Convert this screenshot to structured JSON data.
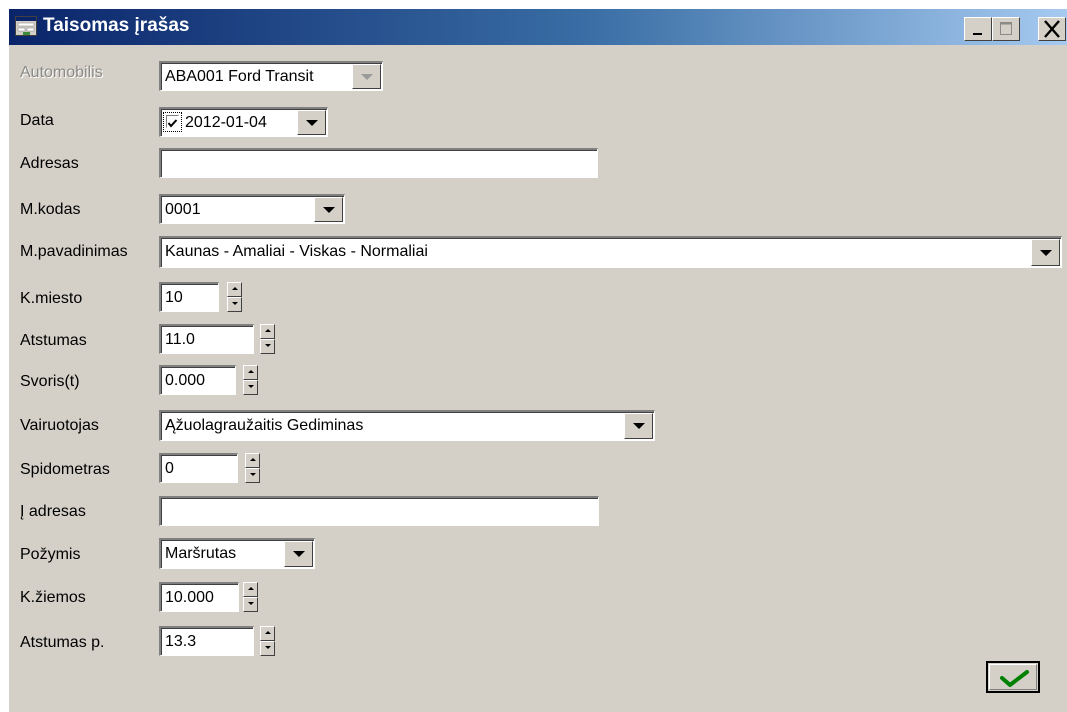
{
  "window": {
    "title": "Taisomas įrašas",
    "icon": "window-form-icon",
    "controls": [
      "minimize-icon",
      "maximize-icon",
      "close-icon"
    ]
  },
  "form": {
    "automobilis": {
      "label": "Automobilis",
      "value": "ABA001 Ford Transit",
      "enabled": false
    },
    "data": {
      "label": "Data",
      "checked": true,
      "value": "2012-01-04"
    },
    "adresas": {
      "label": "Adresas",
      "value": ""
    },
    "m_kodas": {
      "label": "M.kodas",
      "value": "0001"
    },
    "m_pavadinimas": {
      "label": "M.pavadinimas",
      "value": "Kaunas - Amaliai - Viskas - Normaliai"
    },
    "k_miesto": {
      "label": "K.miesto",
      "value": "10"
    },
    "atstumas": {
      "label": "Atstumas",
      "value": "11.0"
    },
    "svoris": {
      "label": "Svoris(t)",
      "value": "0.000"
    },
    "vairuotojas": {
      "label": "Vairuotojas",
      "value": "Ąžuolagraužaitis Gediminas"
    },
    "spidometras": {
      "label": "Spidometras",
      "value": "0"
    },
    "i_adresas": {
      "label": "Į adresas",
      "value": ""
    },
    "pozymis": {
      "label": "Požymis",
      "value": "Maršrutas"
    },
    "k_ziemos": {
      "label": "K.žiemos",
      "value": "10.000"
    },
    "atstumas_p": {
      "label": "Atstumas p.",
      "value": "13.3"
    }
  },
  "ok_button": {
    "icon": "checkmark-icon",
    "color": "#008000"
  },
  "colors": {
    "titlebar_start": "#0a246a",
    "titlebar_end": "#a6caf0",
    "face": "#d4d0c8"
  }
}
